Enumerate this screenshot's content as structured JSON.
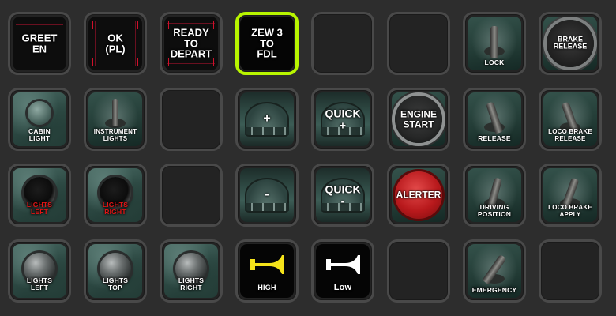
{
  "deck": {
    "accent_color": "#b8f500",
    "keys": [
      {
        "id": "greet-en",
        "text": "GREET\nEN",
        "style": "framed"
      },
      {
        "id": "ok-pl",
        "text": "OK\n(PL)",
        "style": "framed"
      },
      {
        "id": "ready-to-depart",
        "text": "READY\nTO\nDEPART",
        "style": "framed"
      },
      {
        "id": "zew3-to-fdl",
        "text": "ZEW 3\nTO\nFDL",
        "style": "selected"
      },
      {
        "id": "empty-1",
        "text": "",
        "style": "empty"
      },
      {
        "id": "empty-2",
        "text": "",
        "style": "empty"
      },
      {
        "id": "lock",
        "text": "LOCK",
        "style": "lever"
      },
      {
        "id": "brake-release",
        "text": "BRAKE\nRELEASE",
        "style": "brake"
      },
      {
        "id": "cabin-light",
        "text": "CABIN\nLIGHT",
        "style": "cab-switch"
      },
      {
        "id": "instrument-lights",
        "text": "INSTRUMENT\nLIGHTS",
        "style": "cab-lever"
      },
      {
        "id": "empty-3",
        "text": "",
        "style": "empty"
      },
      {
        "id": "throttle-plus",
        "text": "+",
        "style": "console"
      },
      {
        "id": "quick-plus",
        "text": "QUICK\n+",
        "style": "console"
      },
      {
        "id": "engine-start",
        "text": "ENGINE\nSTART",
        "style": "engine"
      },
      {
        "id": "release",
        "text": "RELEASE",
        "style": "lever"
      },
      {
        "id": "loco-brake-release",
        "text": "LOCO BRAKE\nRELEASE",
        "style": "lever"
      },
      {
        "id": "lights-left-red",
        "text": "LIGHTS\nLEFT",
        "style": "knob-dark-red"
      },
      {
        "id": "lights-right-red",
        "text": "LIGHTS\nRIGHT",
        "style": "knob-dark-red"
      },
      {
        "id": "empty-4",
        "text": "",
        "style": "empty"
      },
      {
        "id": "throttle-minus",
        "text": "-",
        "style": "console"
      },
      {
        "id": "quick-minus",
        "text": "QUICK\n-",
        "style": "console"
      },
      {
        "id": "alerter",
        "text": "ALERTER",
        "style": "alert"
      },
      {
        "id": "driving-position",
        "text": "DRIVING\nPOSITION",
        "style": "lever"
      },
      {
        "id": "loco-brake-apply",
        "text": "LOCO BRAKE\nAPPLY",
        "style": "lever"
      },
      {
        "id": "lights-left",
        "text": "LIGHTS\nLEFT",
        "style": "knob"
      },
      {
        "id": "lights-top",
        "text": "LIGHTS\nTOP",
        "style": "knob"
      },
      {
        "id": "lights-right",
        "text": "LIGHTS\nRIGHT",
        "style": "knob"
      },
      {
        "id": "horn-high",
        "text": "HIGH",
        "style": "horn-yellow"
      },
      {
        "id": "horn-low",
        "text": "Low",
        "style": "horn-white"
      },
      {
        "id": "empty-5",
        "text": "",
        "style": "empty"
      },
      {
        "id": "emergency",
        "text": "EMERGENCY",
        "style": "lever"
      },
      {
        "id": "empty-6",
        "text": "",
        "style": "empty"
      }
    ]
  }
}
